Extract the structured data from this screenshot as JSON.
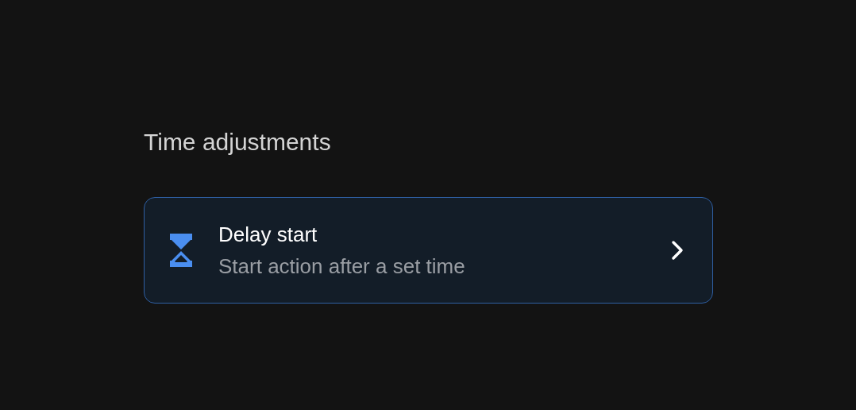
{
  "section": {
    "title": "Time adjustments",
    "items": [
      {
        "title": "Delay start",
        "subtitle": "Start action after a set time"
      }
    ]
  }
}
